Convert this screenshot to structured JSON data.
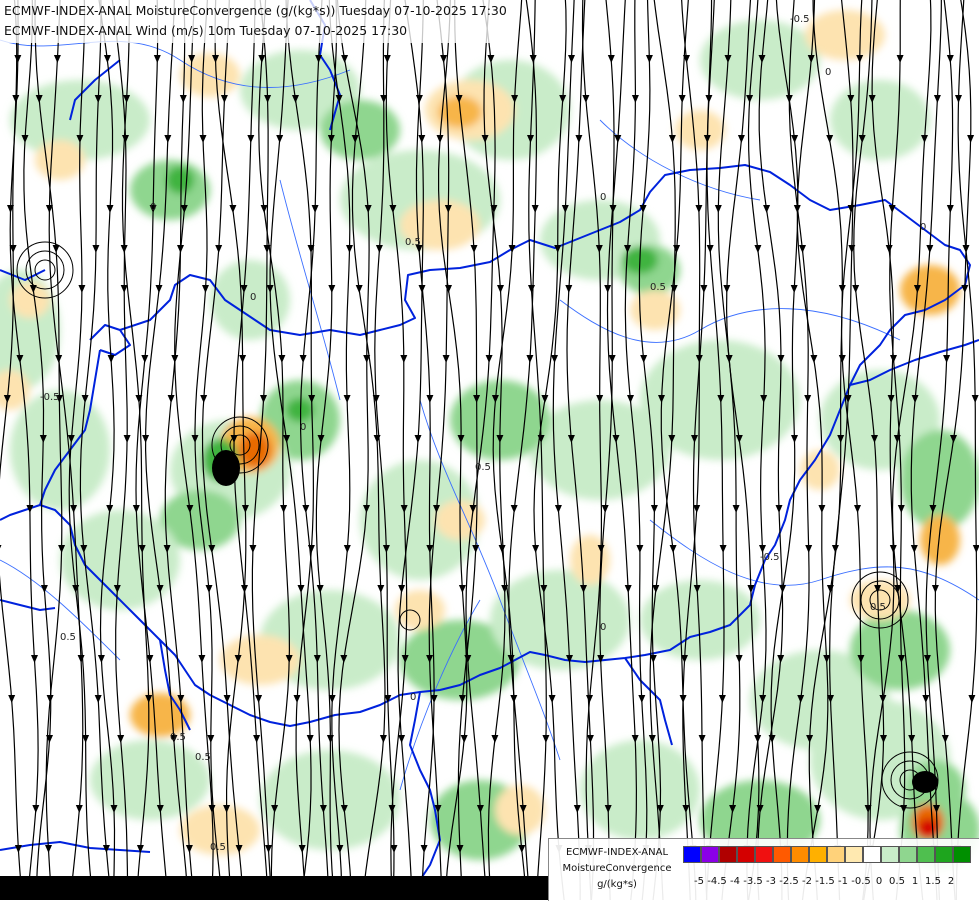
{
  "header": {
    "title_line1": "ECMWF-INDEX-ANAL MoistureConvergence (g/(kg*s)) Tuesday 07-10-2025 17:30",
    "title_line2": "ECMWF-INDEX-ANAL Wind (m/s) 10m Tuesday 07-10-2025 17:30"
  },
  "map_labels": [
    "0.5",
    "0",
    "-0.5",
    "0",
    "0.5",
    "-0.5",
    "0",
    "0.5",
    "0",
    "0.5",
    "0",
    "-0.5",
    "0.5",
    "0",
    "0.5",
    "0",
    "0.5",
    "0",
    "0.5"
  ],
  "legend": {
    "title_line1": "ECMWF-INDEX-ANAL",
    "title_line2": "MoistureConvergence",
    "title_line3": "g/(kg*s)",
    "ticks": [
      "-5",
      "-4.5",
      "-4",
      "-3.5",
      "-3",
      "-2.5",
      "-2",
      "-1.5",
      "-1",
      "-0.5",
      "0",
      "0.5",
      "1",
      "1.5",
      "2"
    ],
    "colors": [
      "#0000ff",
      "#8a00e6",
      "#b00000",
      "#d40000",
      "#f01010",
      "#ff5a00",
      "#ff8c00",
      "#ffb000",
      "#ffd27a",
      "#ffe9b0",
      "#ffffff",
      "#c9ecc9",
      "#8fd68f",
      "#4fbf4f",
      "#1ea51e",
      "#008f00"
    ]
  },
  "colors": {
    "border": "#0022dd",
    "river": "#3b6fff",
    "streamline": "#000000",
    "green_light": "#c9ecc9",
    "green_mid": "#8fd68f",
    "green_dark": "#3fb43f",
    "orange_light": "#fde3b0",
    "orange_mid": "#f7b54a",
    "orange_dark": "#e86a00",
    "red": "#d40000"
  }
}
